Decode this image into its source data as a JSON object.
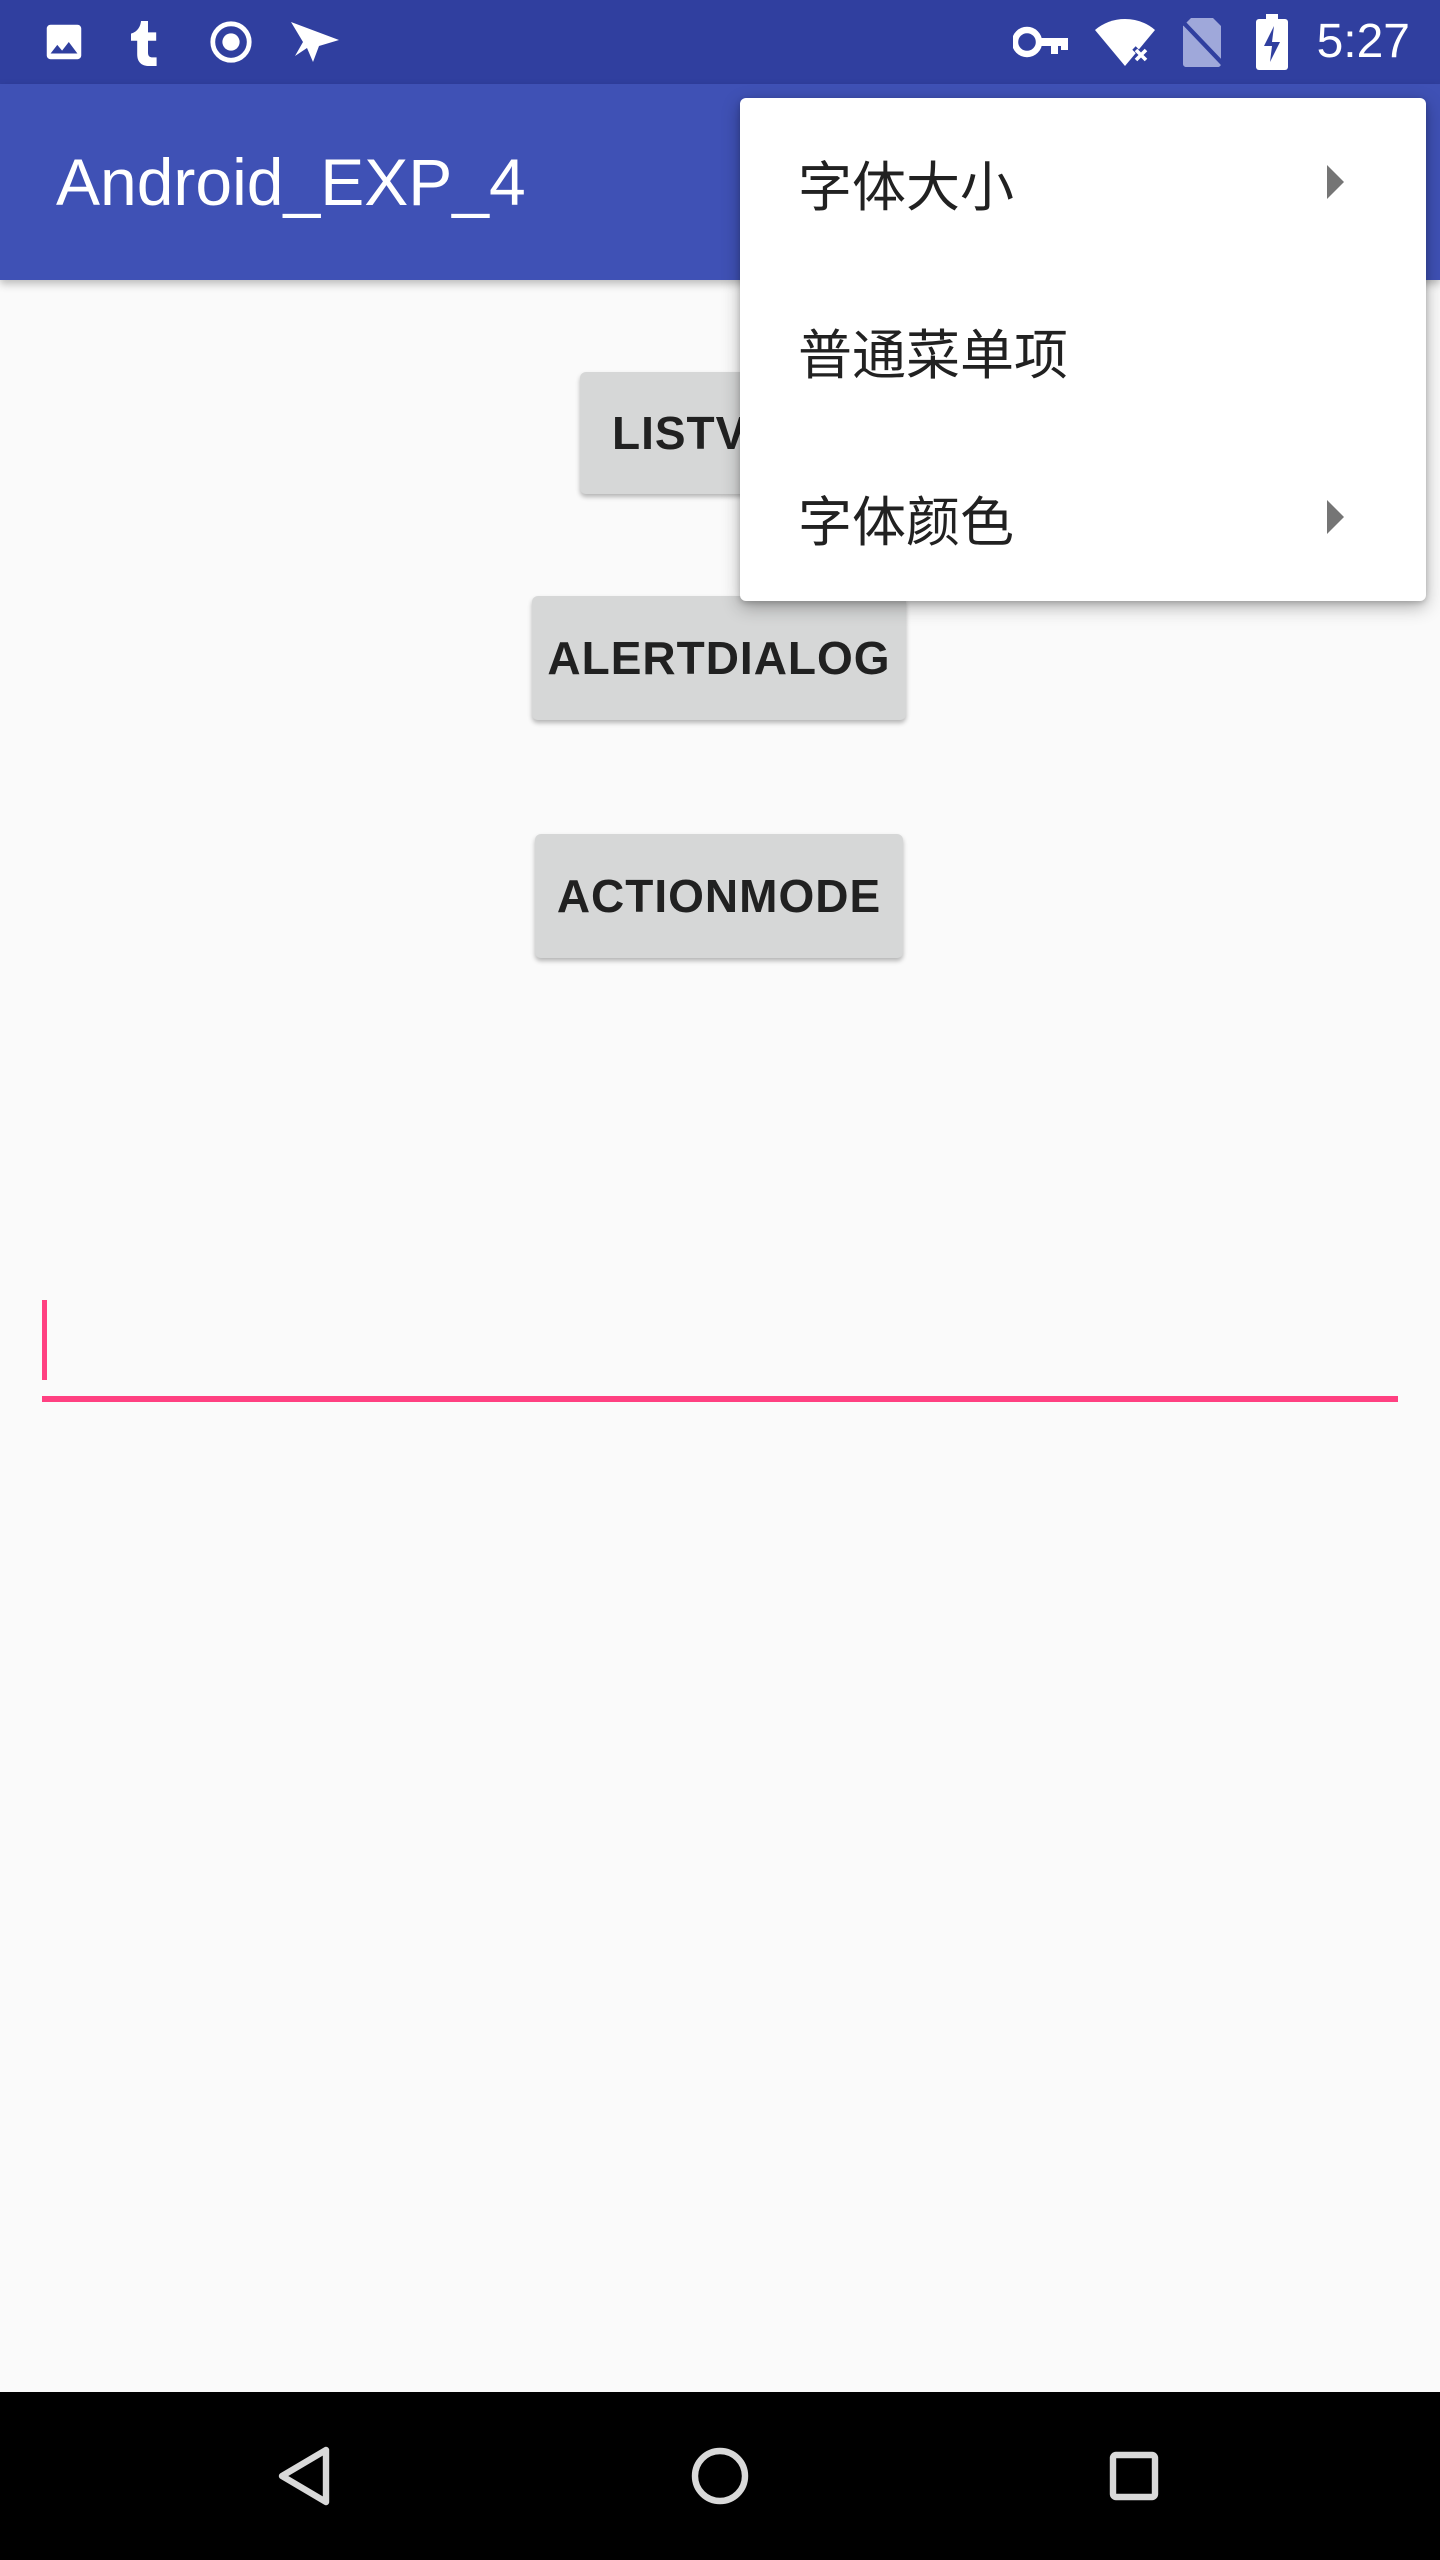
{
  "status_bar": {
    "time": "5:27",
    "background_color": "#303f9f",
    "notification_icons": [
      "image-icon",
      "tumblr-icon",
      "record-icon",
      "paper-plane-icon"
    ],
    "system_icons": [
      "vpn-key-icon",
      "wifi-no-internet-icon",
      "no-sim-icon",
      "battery-charging-icon"
    ]
  },
  "app_bar": {
    "title": "Android_EXP_4",
    "background_color": "#3f51b5"
  },
  "buttons": {
    "listview_label": "LISTVIEW",
    "alertdialog_label": "ALERTDIALOG",
    "actionmode_label": "ACTIONMODE"
  },
  "edit_text": {
    "value": "",
    "accent_color": "#ff4081"
  },
  "overflow_menu": {
    "items": [
      {
        "label": "字体大小",
        "has_submenu": true
      },
      {
        "label": "普通菜单项",
        "has_submenu": false
      },
      {
        "label": "字体颜色",
        "has_submenu": true
      }
    ]
  },
  "nav_bar": {
    "buttons": [
      "back-icon",
      "home-icon",
      "recents-icon"
    ]
  }
}
